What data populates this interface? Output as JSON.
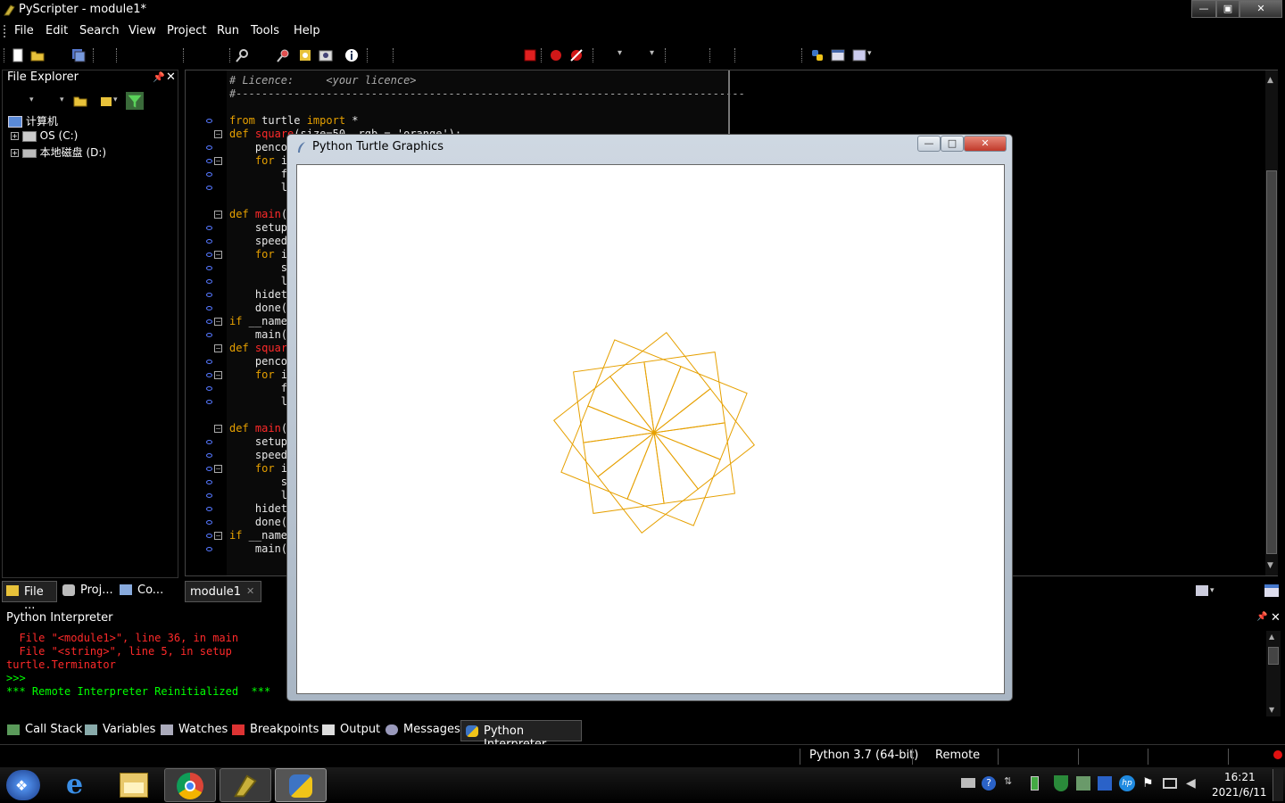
{
  "window": {
    "title": "PyScripter - module1*"
  },
  "menu": [
    "File",
    "Edit",
    "Search",
    "View",
    "Project",
    "Run",
    "Tools",
    "Help"
  ],
  "file_explorer": {
    "title": "File Explorer",
    "tree": [
      "计算机",
      "OS (C:)",
      "本地磁盘 (D:)"
    ]
  },
  "editor": {
    "lines": [
      {
        "html": "<span class='cm'># Licence:     &lt;your licence&gt;</span>"
      },
      {
        "html": "<span class='cm'>#-------------------------------------------------------------------------------</span>"
      },
      {
        "html": ""
      },
      {
        "html": "<span class='kw'>from</span> turtle <span class='kw'>import</span> *"
      },
      {
        "html": "<span class='kw'>def</span> <span class='fn'>square</span>(size=50, rgb = 'orange'):"
      },
      {
        "html": "    penco"
      },
      {
        "html": "    <span class='kw'>for</span> i"
      },
      {
        "html": "        f"
      },
      {
        "html": "        l"
      },
      {
        "html": ""
      },
      {
        "html": "<span class='kw'>def</span> <span class='fn'>main</span>("
      },
      {
        "html": "    setup"
      },
      {
        "html": "    speed"
      },
      {
        "html": "    <span class='kw'>for</span> i"
      },
      {
        "html": "        s"
      },
      {
        "html": "        l"
      },
      {
        "html": "    hidet"
      },
      {
        "html": "    done("
      },
      {
        "html": "<span class='kw'>if</span> __name"
      },
      {
        "html": "    main("
      },
      {
        "html": "<span class='kw'>def</span> <span class='fn'>squar</span>"
      },
      {
        "html": "    penco"
      },
      {
        "html": "    <span class='kw'>for</span> i"
      },
      {
        "html": "        f"
      },
      {
        "html": "        l"
      },
      {
        "html": ""
      },
      {
        "html": "<span class='kw'>def</span> <span class='fn'>main</span>("
      },
      {
        "html": "    setup"
      },
      {
        "html": "    speed"
      },
      {
        "html": "    <span class='kw'>for</span> i"
      },
      {
        "html": "        s"
      },
      {
        "html": "        l"
      },
      {
        "html": "    hidet"
      },
      {
        "html": "    done("
      },
      {
        "html": "<span class='kw'>if</span> __name"
      },
      {
        "html": "    main("
      }
    ],
    "tab": "module1"
  },
  "left_tabs": [
    "File ...",
    "Proj...",
    "Co..."
  ],
  "interpreter": {
    "title": "Python Interpreter",
    "lines": [
      {
        "text": "  File \"<module1>\", line 36, in main",
        "color": "#ff2a2a"
      },
      {
        "text": "  File \"<string>\", line 5, in setup",
        "color": "#ff2a2a"
      },
      {
        "text": "turtle.Terminator",
        "color": "#ff2a2a"
      },
      {
        "text": ">>>",
        "color": "#00ff00"
      },
      {
        "text": "*** Remote Interpreter Reinitialized  ***",
        "color": "#00ff00"
      }
    ]
  },
  "debug_tabs": [
    "Call Stack",
    "Variables",
    "Watches",
    "Breakpoints",
    "Output",
    "Messages",
    "Python Interpreter"
  ],
  "status": {
    "python": "Python 3.7 (64-bit)",
    "mode": "Remote"
  },
  "taskbar": {
    "time": "16:21",
    "date": "2021/6/11"
  },
  "turtle_window": {
    "title": "Python Turtle Graphics",
    "stroke_color": "#e6a000"
  },
  "drawing": {
    "squares": 12,
    "rotation_step_deg": 30
  }
}
